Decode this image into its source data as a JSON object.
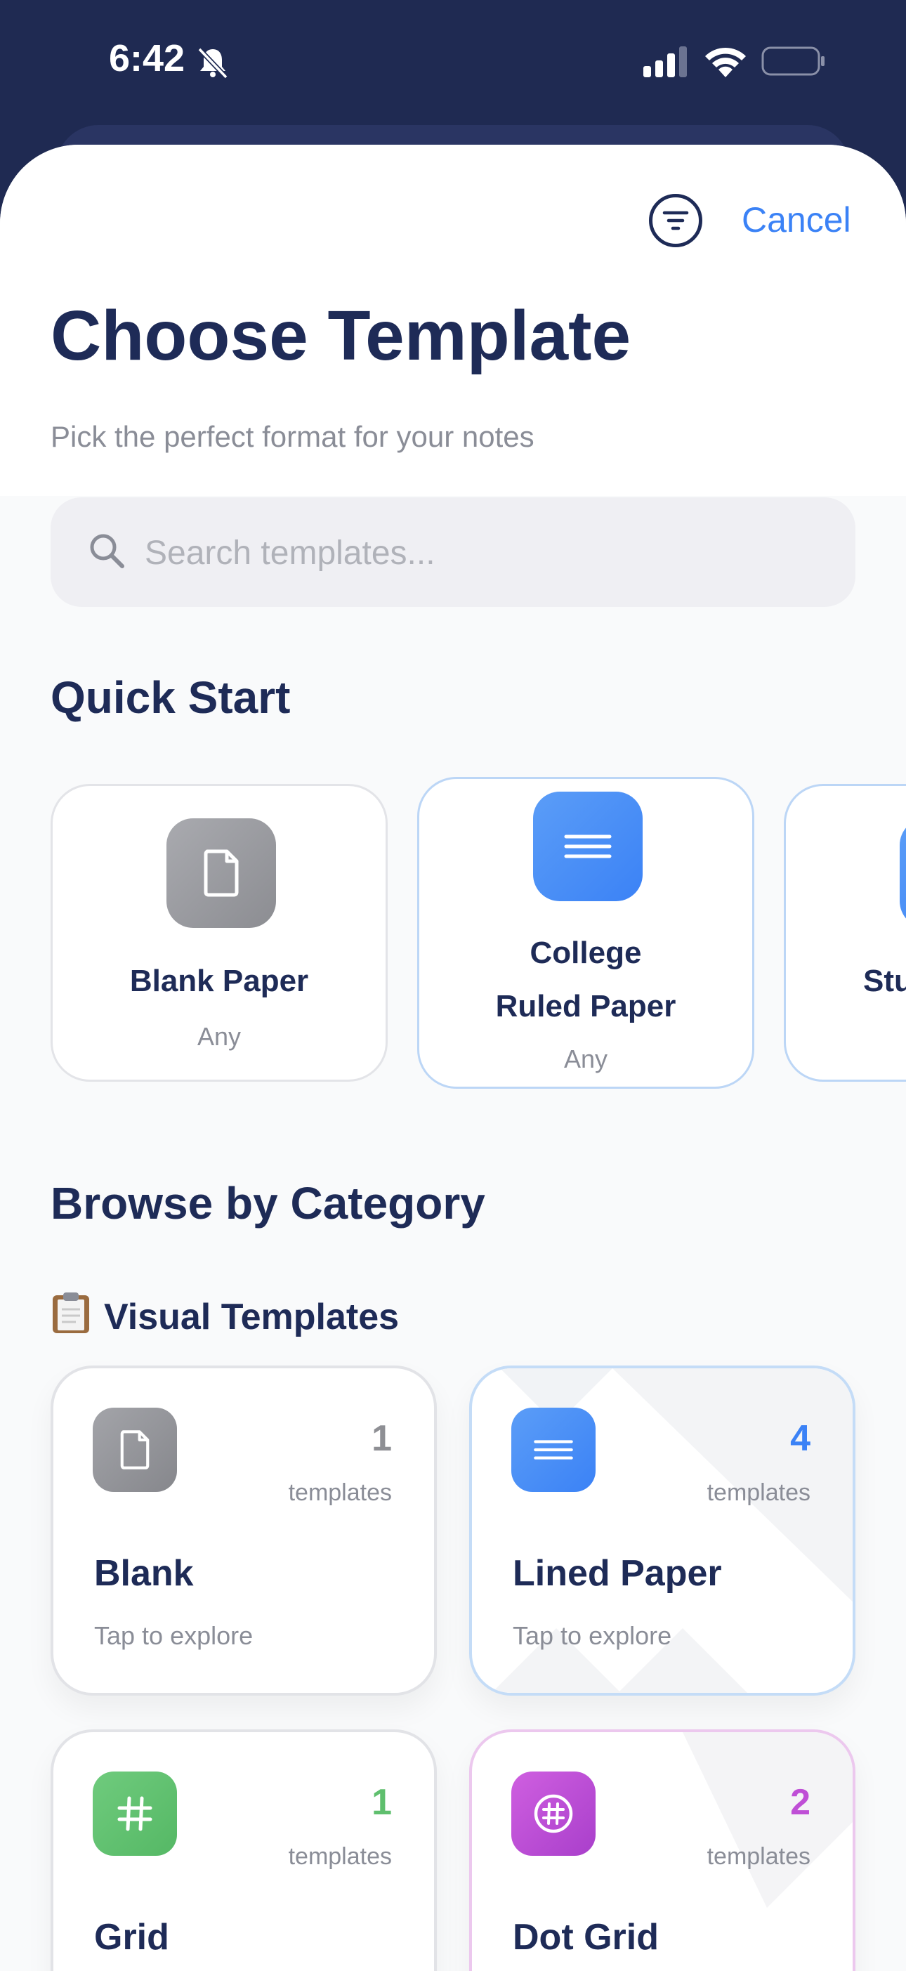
{
  "status_bar": {
    "time": "6:42"
  },
  "header": {
    "cancel_label": "Cancel",
    "title": "Choose Template",
    "subtitle": "Pick the perfect format for your notes"
  },
  "search": {
    "placeholder": "Search templates..."
  },
  "quick_start": {
    "title": "Quick Start",
    "items": [
      {
        "name": "Blank Paper",
        "sub": "Any",
        "icon": "document-icon",
        "color": "#9d9ea3"
      },
      {
        "name_line1": "College",
        "name_line2": "Ruled Paper",
        "sub": "Any",
        "icon": "lines-icon",
        "color": "#3b82f6"
      },
      {
        "name": "Stu",
        "icon": "lines-icon",
        "color": "#3b82f6"
      }
    ]
  },
  "browse": {
    "title": "Browse by Category",
    "group_label": "Visual Templates",
    "group_icon": "clipboard-icon",
    "categories": [
      {
        "name": "Blank",
        "count": "1",
        "unit": "templates",
        "tap": "Tap to explore",
        "icon": "document-icon",
        "color": "#8e8f94"
      },
      {
        "name": "Lined Paper",
        "count": "4",
        "unit": "templates",
        "tap": "Tap to explore",
        "icon": "lines-icon",
        "color": "#3b82f6"
      },
      {
        "name": "Grid",
        "count": "1",
        "unit": "templates",
        "icon": "hash-icon",
        "color": "#5fbf6e"
      },
      {
        "name": "Dot Grid",
        "count": "2",
        "unit": "templates",
        "icon": "dot-grid-icon",
        "color": "#bf4fd6"
      }
    ]
  },
  "colors": {
    "accent": "#3b82f6",
    "navy": "#1e2b57",
    "status_bar_bg": "#1f2a52"
  }
}
